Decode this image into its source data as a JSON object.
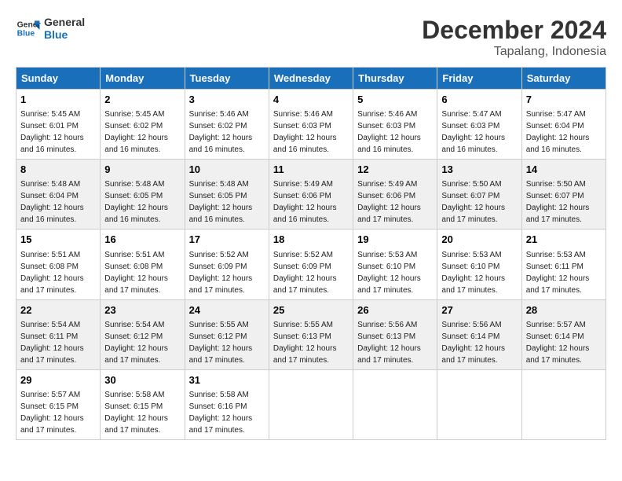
{
  "logo": {
    "line1": "General",
    "line2": "Blue"
  },
  "title": "December 2024",
  "subtitle": "Tapalang, Indonesia",
  "headers": [
    "Sunday",
    "Monday",
    "Tuesday",
    "Wednesday",
    "Thursday",
    "Friday",
    "Saturday"
  ],
  "weeks": [
    [
      {
        "day": "1",
        "sunrise": "5:45 AM",
        "sunset": "6:01 PM",
        "daylight": "12 hours and 16 minutes."
      },
      {
        "day": "2",
        "sunrise": "5:45 AM",
        "sunset": "6:02 PM",
        "daylight": "12 hours and 16 minutes."
      },
      {
        "day": "3",
        "sunrise": "5:46 AM",
        "sunset": "6:02 PM",
        "daylight": "12 hours and 16 minutes."
      },
      {
        "day": "4",
        "sunrise": "5:46 AM",
        "sunset": "6:03 PM",
        "daylight": "12 hours and 16 minutes."
      },
      {
        "day": "5",
        "sunrise": "5:46 AM",
        "sunset": "6:03 PM",
        "daylight": "12 hours and 16 minutes."
      },
      {
        "day": "6",
        "sunrise": "5:47 AM",
        "sunset": "6:03 PM",
        "daylight": "12 hours and 16 minutes."
      },
      {
        "day": "7",
        "sunrise": "5:47 AM",
        "sunset": "6:04 PM",
        "daylight": "12 hours and 16 minutes."
      }
    ],
    [
      {
        "day": "8",
        "sunrise": "5:48 AM",
        "sunset": "6:04 PM",
        "daylight": "12 hours and 16 minutes."
      },
      {
        "day": "9",
        "sunrise": "5:48 AM",
        "sunset": "6:05 PM",
        "daylight": "12 hours and 16 minutes."
      },
      {
        "day": "10",
        "sunrise": "5:48 AM",
        "sunset": "6:05 PM",
        "daylight": "12 hours and 16 minutes."
      },
      {
        "day": "11",
        "sunrise": "5:49 AM",
        "sunset": "6:06 PM",
        "daylight": "12 hours and 16 minutes."
      },
      {
        "day": "12",
        "sunrise": "5:49 AM",
        "sunset": "6:06 PM",
        "daylight": "12 hours and 17 minutes."
      },
      {
        "day": "13",
        "sunrise": "5:50 AM",
        "sunset": "6:07 PM",
        "daylight": "12 hours and 17 minutes."
      },
      {
        "day": "14",
        "sunrise": "5:50 AM",
        "sunset": "6:07 PM",
        "daylight": "12 hours and 17 minutes."
      }
    ],
    [
      {
        "day": "15",
        "sunrise": "5:51 AM",
        "sunset": "6:08 PM",
        "daylight": "12 hours and 17 minutes."
      },
      {
        "day": "16",
        "sunrise": "5:51 AM",
        "sunset": "6:08 PM",
        "daylight": "12 hours and 17 minutes."
      },
      {
        "day": "17",
        "sunrise": "5:52 AM",
        "sunset": "6:09 PM",
        "daylight": "12 hours and 17 minutes."
      },
      {
        "day": "18",
        "sunrise": "5:52 AM",
        "sunset": "6:09 PM",
        "daylight": "12 hours and 17 minutes."
      },
      {
        "day": "19",
        "sunrise": "5:53 AM",
        "sunset": "6:10 PM",
        "daylight": "12 hours and 17 minutes."
      },
      {
        "day": "20",
        "sunrise": "5:53 AM",
        "sunset": "6:10 PM",
        "daylight": "12 hours and 17 minutes."
      },
      {
        "day": "21",
        "sunrise": "5:53 AM",
        "sunset": "6:11 PM",
        "daylight": "12 hours and 17 minutes."
      }
    ],
    [
      {
        "day": "22",
        "sunrise": "5:54 AM",
        "sunset": "6:11 PM",
        "daylight": "12 hours and 17 minutes."
      },
      {
        "day": "23",
        "sunrise": "5:54 AM",
        "sunset": "6:12 PM",
        "daylight": "12 hours and 17 minutes."
      },
      {
        "day": "24",
        "sunrise": "5:55 AM",
        "sunset": "6:12 PM",
        "daylight": "12 hours and 17 minutes."
      },
      {
        "day": "25",
        "sunrise": "5:55 AM",
        "sunset": "6:13 PM",
        "daylight": "12 hours and 17 minutes."
      },
      {
        "day": "26",
        "sunrise": "5:56 AM",
        "sunset": "6:13 PM",
        "daylight": "12 hours and 17 minutes."
      },
      {
        "day": "27",
        "sunrise": "5:56 AM",
        "sunset": "6:14 PM",
        "daylight": "12 hours and 17 minutes."
      },
      {
        "day": "28",
        "sunrise": "5:57 AM",
        "sunset": "6:14 PM",
        "daylight": "12 hours and 17 minutes."
      }
    ],
    [
      {
        "day": "29",
        "sunrise": "5:57 AM",
        "sunset": "6:15 PM",
        "daylight": "12 hours and 17 minutes."
      },
      {
        "day": "30",
        "sunrise": "5:58 AM",
        "sunset": "6:15 PM",
        "daylight": "12 hours and 17 minutes."
      },
      {
        "day": "31",
        "sunrise": "5:58 AM",
        "sunset": "6:16 PM",
        "daylight": "12 hours and 17 minutes."
      },
      null,
      null,
      null,
      null
    ]
  ]
}
